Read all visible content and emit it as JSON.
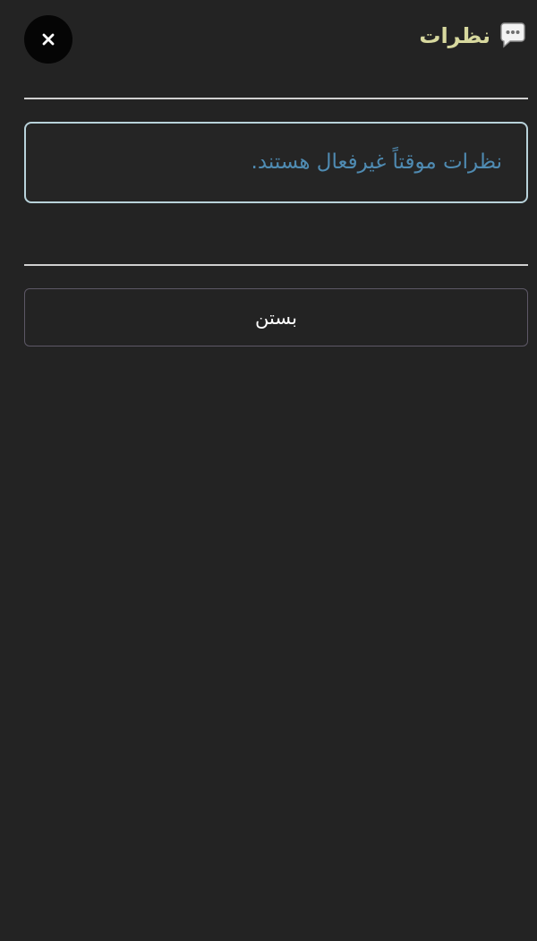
{
  "header": {
    "title": "نظرات",
    "close_label": "×"
  },
  "notice": {
    "message": "نظرات موقتاً غیرفعال هستند."
  },
  "footer": {
    "close_label": "بستن"
  },
  "colors": {
    "background": "#232323",
    "title": "#d7d89e",
    "notice_text": "#4f8bb2",
    "notice_border": "#b8d2da",
    "divider": "#cfcfcf",
    "button_border": "#5d5866",
    "close_button": "#050505"
  },
  "icons": {
    "title_icon": "chat-bubble-icon",
    "close_icon": "close-icon"
  }
}
